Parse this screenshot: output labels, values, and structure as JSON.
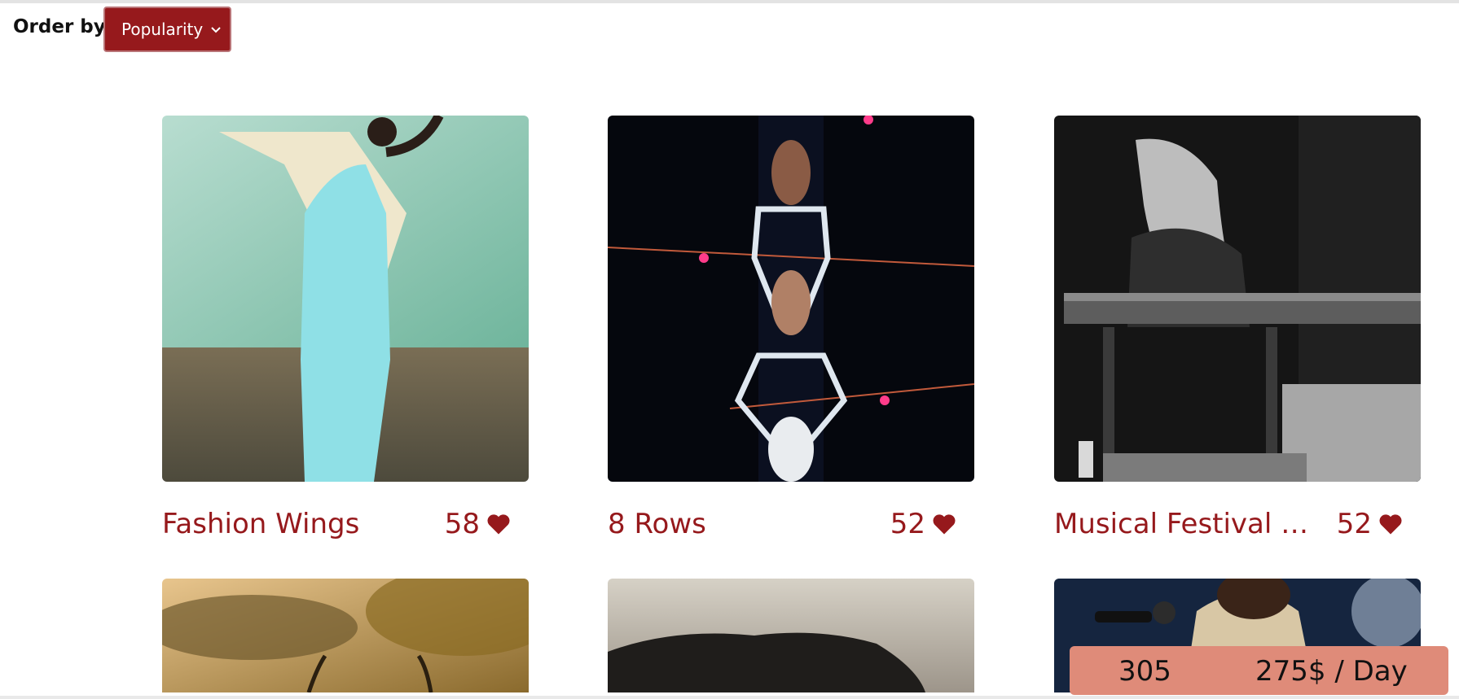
{
  "toolbar": {
    "order_label": "Order by",
    "order_value": "Popularity"
  },
  "items": [
    {
      "title": "Fashion Wings",
      "likes": "58"
    },
    {
      "title": "8 Rows",
      "likes": "52"
    },
    {
      "title": "Musical Festival K...",
      "likes": "52"
    }
  ],
  "footer_bar": {
    "count": "305",
    "rate": "275$ / Day"
  },
  "colors": {
    "brand": "#96191c",
    "price_bar": "#df8b79"
  }
}
